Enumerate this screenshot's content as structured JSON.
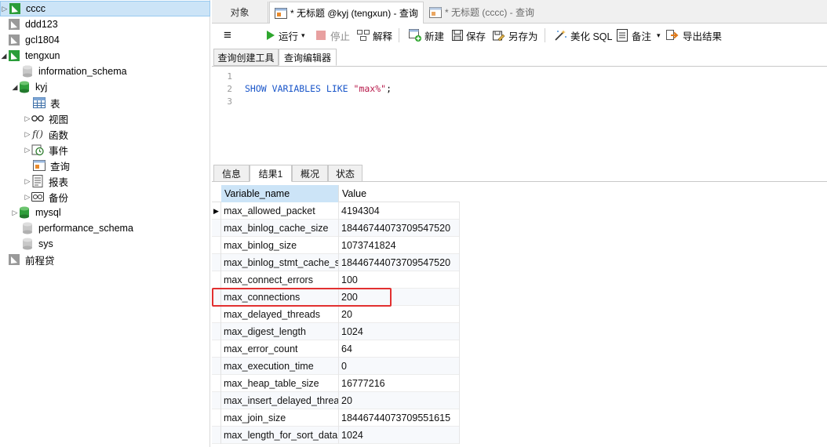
{
  "sidebar": {
    "connections": [
      {
        "label": "cccc",
        "selected": true,
        "expanded": false,
        "active": true
      },
      {
        "label": "ddd123",
        "active": false
      },
      {
        "label": "gcl1804",
        "active": false
      },
      {
        "label": "tengxun",
        "expanded": true,
        "active": true
      }
    ],
    "databases": [
      {
        "label": "information_schema"
      },
      {
        "label": "kyj",
        "expanded": true
      },
      {
        "label": "mysql"
      },
      {
        "label": "performance_schema"
      },
      {
        "label": "sys"
      }
    ],
    "kyj_children": [
      {
        "label": "表",
        "icon": "table-icon"
      },
      {
        "label": "视图",
        "icon": "view-icon"
      },
      {
        "label": "函数",
        "icon": "function-icon"
      },
      {
        "label": "事件",
        "icon": "event-icon"
      },
      {
        "label": "查询",
        "icon": "query-icon"
      },
      {
        "label": "报表",
        "icon": "report-icon"
      },
      {
        "label": "备份",
        "icon": "backup-icon"
      }
    ],
    "extra_connection": {
      "label": "前程贷"
    }
  },
  "doc_tabs": [
    {
      "label": "对象"
    },
    {
      "label": "* 无标题 @kyj (tengxun) - 查询",
      "active": true
    },
    {
      "label": "* 无标题 (cccc) - 查询"
    }
  ],
  "toolbar": {
    "menu": "≡",
    "run": "运行",
    "run_dropdown": "▾",
    "stop": "停止",
    "explain": "解释",
    "new": "新建",
    "save": "保存",
    "save_as": "另存为",
    "beautify": "美化 SQL",
    "comment": "备注",
    "comment_dropdown": "▾",
    "export": "导出结果"
  },
  "editor_tabs": [
    {
      "label": "查询创建工具"
    },
    {
      "label": "查询编辑器",
      "active": true
    }
  ],
  "editor": {
    "line_numbers": [
      "1",
      "2",
      "3"
    ],
    "code": {
      "kw1": "SHOW",
      "kw2": "VARIABLES",
      "kw3": "LIKE",
      "str": "\"max%\"",
      "end": ";"
    }
  },
  "result_tabs": [
    {
      "label": "信息"
    },
    {
      "label": "结果1",
      "active": true
    },
    {
      "label": "概况"
    },
    {
      "label": "状态"
    }
  ],
  "grid": {
    "columns": [
      "Variable_name",
      "Value"
    ],
    "rows": [
      [
        "max_allowed_packet",
        "4194304"
      ],
      [
        "max_binlog_cache_size",
        "18446744073709547520"
      ],
      [
        "max_binlog_size",
        "1073741824"
      ],
      [
        "max_binlog_stmt_cache_si",
        "18446744073709547520"
      ],
      [
        "max_connect_errors",
        "100"
      ],
      [
        "max_connections",
        "200"
      ],
      [
        "max_delayed_threads",
        "20"
      ],
      [
        "max_digest_length",
        "1024"
      ],
      [
        "max_error_count",
        "64"
      ],
      [
        "max_execution_time",
        "0"
      ],
      [
        "max_heap_table_size",
        "16777216"
      ],
      [
        "max_insert_delayed_threa",
        "20"
      ],
      [
        "max_join_size",
        "18446744073709551615"
      ],
      [
        "max_length_for_sort_data",
        "1024"
      ]
    ],
    "current_row_marker": "▶",
    "highlighted_row": "max_connections"
  },
  "colors": {
    "selection": "#cce4f7",
    "highlight_border": "#e23030",
    "keyword": "#1a56c9",
    "string": "#b7194a"
  }
}
